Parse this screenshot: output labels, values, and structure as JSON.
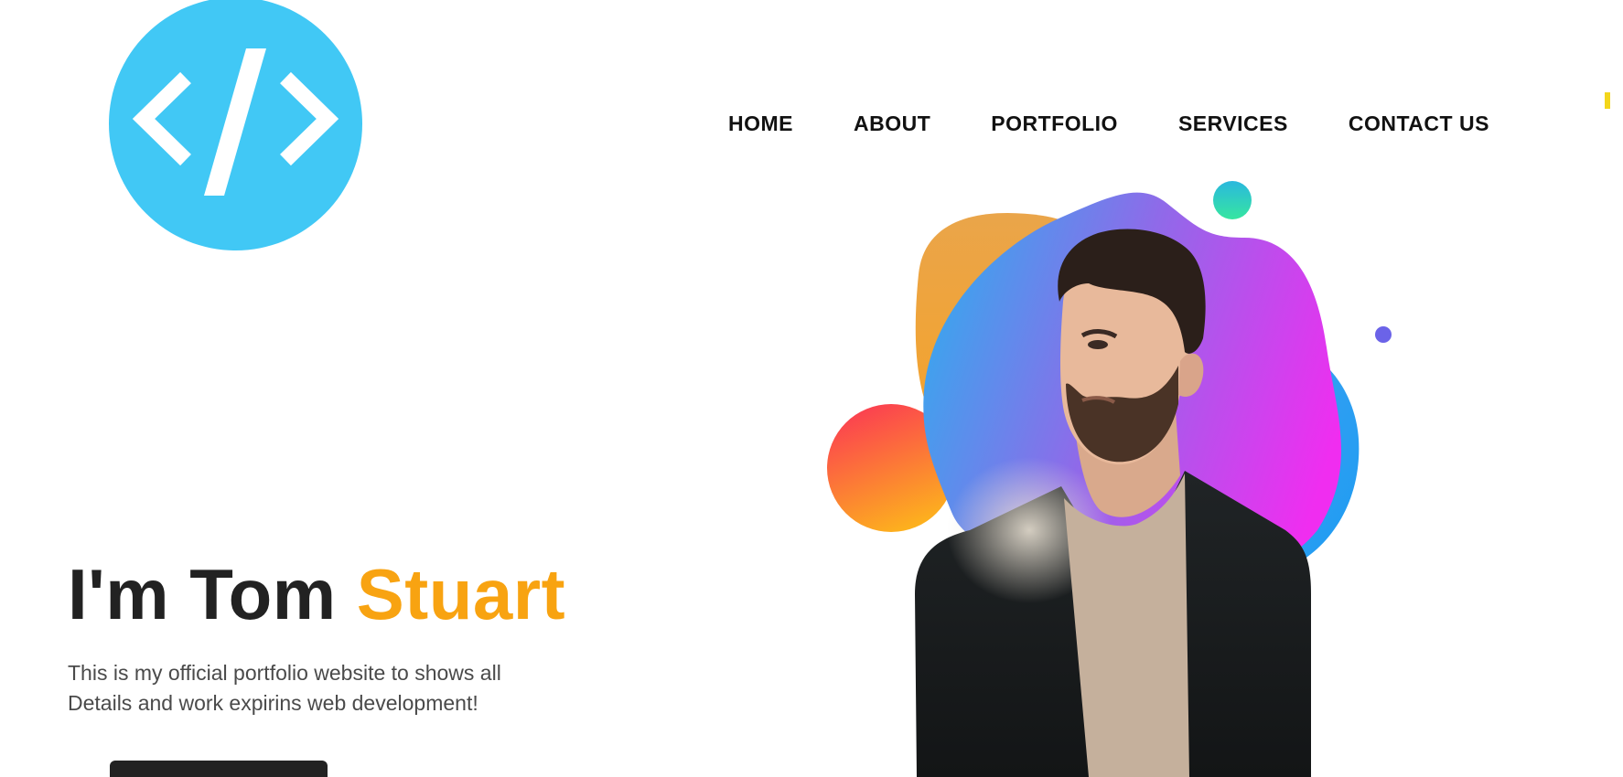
{
  "header": {
    "logo_icon": "code-brackets-icon",
    "logo_color": "#41c8f5"
  },
  "nav": {
    "items": [
      {
        "label": "HOME"
      },
      {
        "label": "ABOUT"
      },
      {
        "label": "PORTFOLIO"
      },
      {
        "label": "SERVICES"
      },
      {
        "label": "CONTACT US"
      }
    ]
  },
  "hero": {
    "title_prefix": "I'm Tom ",
    "title_highlight": "Stuart",
    "accent_color": "#f8a311",
    "intro_line1": "This is my official portfolio website to shows all",
    "intro_line2": "Details and work expirins web development!",
    "cta_label": ""
  },
  "colors": {
    "text_dark": "#222222",
    "yellow_mark": "#f3d61b"
  }
}
